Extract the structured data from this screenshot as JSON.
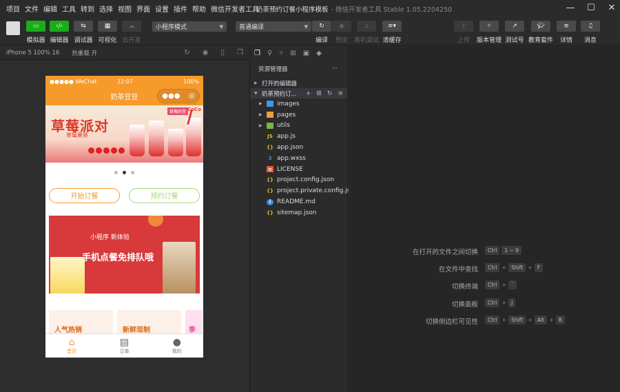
{
  "menu": [
    "项目",
    "文件",
    "编辑",
    "工具",
    "转到",
    "选择",
    "视图",
    "界面",
    "设置",
    "插件",
    "帮助",
    "微信开发者工具"
  ],
  "window": {
    "title": "奶茶预约订餐小程序模板",
    "subtitle": "- 微信开发者工具 Stable 1.05.2204250"
  },
  "window_controls": {
    "minimize": "—",
    "maximize": "☐",
    "close": "✕"
  },
  "toolbar": {
    "simulator": "模拟器",
    "editor": "编辑器",
    "debugger": "调试器",
    "visual": "可视化",
    "cloud": "云开发",
    "mode_select": "小程序模式",
    "compile_select": "普通编译",
    "compile": "编译",
    "preview": "预览",
    "remote_debug": "真机调试",
    "clear_cache": "清缓存",
    "upload": "上传",
    "version": "版本管理",
    "test": "测试号",
    "edu": "教育套件",
    "details": "详情",
    "messages": "消息"
  },
  "simbar": {
    "device": "iPhone 5 100% 16",
    "hot_reload": "热重载 开"
  },
  "phone": {
    "carrier": "●●●●● WeChat",
    "time": "22:07",
    "battery": "100%",
    "nav_title": "奶茶豆豆",
    "banner": {
      "brand": "草莓派对",
      "sub": "草莓果茶",
      "tag": "草莓奶昔",
      "logo": "CoCo"
    },
    "btn_start": "开始订餐",
    "btn_book": "预约订餐",
    "ad": {
      "head": "小程序  新体验",
      "main": "手机点餐免排队哦"
    },
    "cards": [
      {
        "label": "人气热销",
        "color": "#d86a1a"
      },
      {
        "label": "新鲜现制",
        "color": "#d86a1a"
      },
      {
        "label": "季",
        "color": "#e84f9f"
      }
    ],
    "tabs": [
      {
        "label": "首页",
        "icon": "⌂"
      },
      {
        "label": "订单",
        "icon": "▤"
      },
      {
        "label": "我的",
        "icon": "●"
      }
    ]
  },
  "explorer": {
    "title": "资源管理器",
    "more": "···",
    "open_editors": "打开的编辑器",
    "project": "奶茶预约订...",
    "files": [
      {
        "name": "images",
        "type": "folder",
        "icon": "folder-blue"
      },
      {
        "name": "pages",
        "type": "folder",
        "icon": "folder-orange"
      },
      {
        "name": "utils",
        "type": "folder",
        "icon": "folder-green"
      },
      {
        "name": "app.js",
        "type": "file",
        "icon": "JS"
      },
      {
        "name": "app.json",
        "type": "file",
        "icon": "{}"
      },
      {
        "name": "app.wxss",
        "type": "file",
        "icon": "3"
      },
      {
        "name": "LICENSE",
        "type": "file",
        "icon": "≡"
      },
      {
        "name": "project.config.json",
        "type": "file",
        "icon": "{}"
      },
      {
        "name": "project.private.config.js...",
        "type": "file",
        "icon": "{}"
      },
      {
        "name": "README.md",
        "type": "file",
        "icon": "i"
      },
      {
        "name": "sitemap.json",
        "type": "file",
        "icon": "{}"
      }
    ]
  },
  "shortcuts": [
    {
      "label": "在打开的文件之间切换",
      "keys": [
        "Ctrl",
        "1 ~ 9"
      ]
    },
    {
      "label": "在文件中查找",
      "keys": [
        "Ctrl",
        "Shift",
        "F"
      ]
    },
    {
      "label": "切换终端",
      "keys": [
        "Ctrl",
        "`"
      ]
    },
    {
      "label": "切换面板",
      "keys": [
        "Ctrl",
        "J"
      ]
    },
    {
      "label": "切换侧边栏可见性",
      "keys": [
        "Ctrl",
        "Shift",
        "Alt",
        "B"
      ]
    }
  ]
}
